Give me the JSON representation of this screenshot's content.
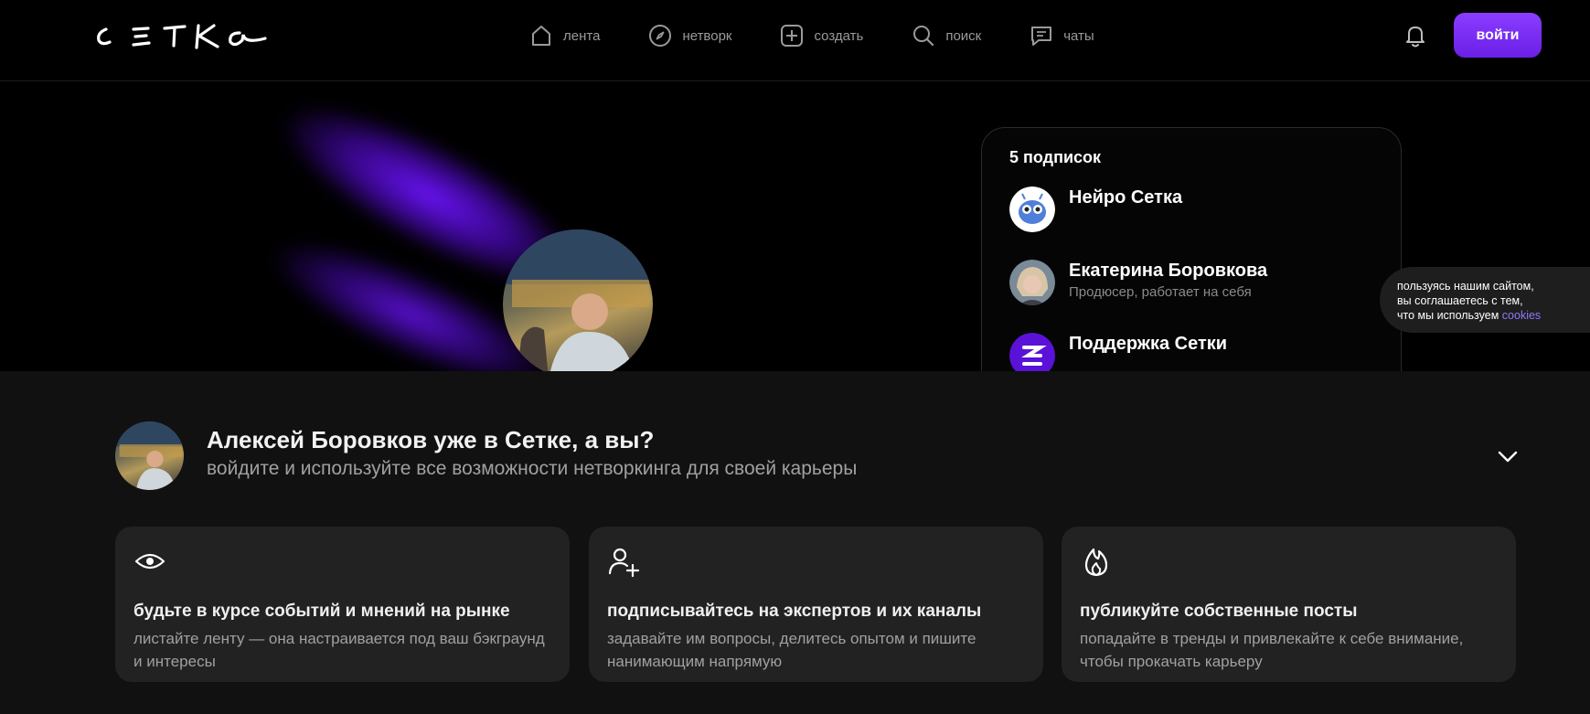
{
  "header": {
    "logo_text": "СЕТКА",
    "nav": [
      {
        "label": "лента",
        "icon": "home-icon"
      },
      {
        "label": "нетворк",
        "icon": "compass-icon"
      },
      {
        "label": "создать",
        "icon": "plus-square-icon"
      },
      {
        "label": "поиск",
        "icon": "search-icon"
      },
      {
        "label": "чаты",
        "icon": "chat-icon"
      }
    ],
    "login_label": "войти",
    "accent": "#7a2cff"
  },
  "subscriptions": {
    "title": "5 подписок",
    "items": [
      {
        "name": "Нейро Сетка",
        "desc": ""
      },
      {
        "name": "Екатерина Боровкова",
        "desc": "Продюсер, работает на себя"
      },
      {
        "name": "Поддержка Сетки",
        "desc": ""
      }
    ]
  },
  "cookie": {
    "line1": "пользуясь нашим сайтом,",
    "line2": "вы соглашаетесь с тем,",
    "line3": "что мы используем",
    "link": "cookies"
  },
  "promo": {
    "title": "Алексей Боровков уже в Сетке, а вы?",
    "subtitle": "войдите и используйте все возможности нетворкинга для своей карьеры"
  },
  "features": [
    {
      "icon": "eye-icon",
      "title": "будьте в курсе событий и мнений на рынке",
      "desc": "листайте ленту — она настраивается под ваш бэкграунд и интересы"
    },
    {
      "icon": "user-plus-icon",
      "title": "подписывайтесь на экспертов и их каналы",
      "desc": "задавайте им вопросы, делитесь опытом и пишите нанимающим напрямую"
    },
    {
      "icon": "flame-icon",
      "title": "публикуйте собственные посты",
      "desc": "попадайте в тренды и привлекайте к себе внимание, чтобы прокачать карьеру"
    }
  ]
}
